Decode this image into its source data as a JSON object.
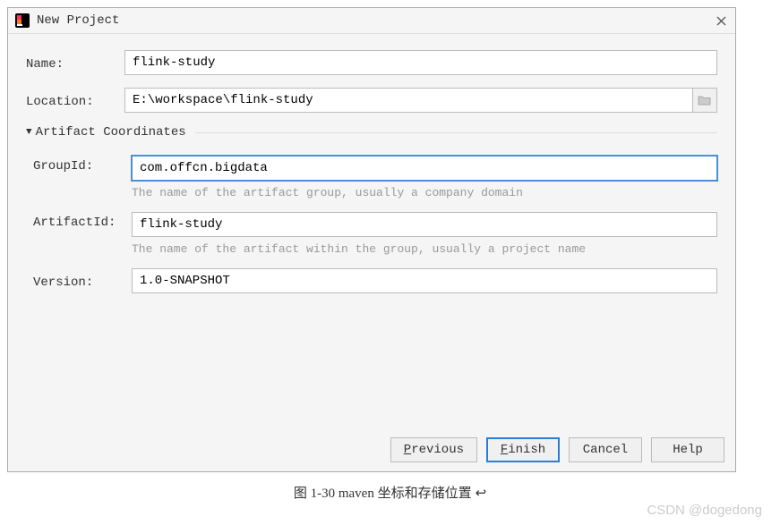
{
  "window": {
    "title": "New Project",
    "close_icon": "×"
  },
  "form": {
    "name_label": "Name:",
    "name_value": "flink-study",
    "location_label": "Location:",
    "location_value": "E:\\workspace\\flink-study",
    "section_title": "Artifact Coordinates",
    "group_label": "GroupId:",
    "group_value": "com.offcn.bigdata",
    "group_hint": "The name of the artifact group, usually a company domain",
    "artifact_label": "ArtifactId:",
    "artifact_value": "flink-study",
    "artifact_hint": "The name of the artifact within the group, usually a project name",
    "version_label": "Version:",
    "version_value": "1.0-SNAPSHOT"
  },
  "buttons": {
    "previous": "Previous",
    "finish": "Finish",
    "cancel": "Cancel",
    "help": "Help"
  },
  "caption": "图 1-30 maven 坐标和存储位置",
  "watermark": "CSDN @dogedong"
}
